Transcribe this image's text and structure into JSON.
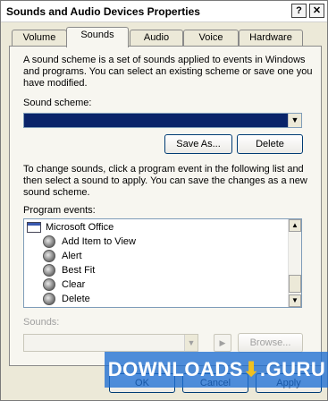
{
  "window": {
    "title": "Sounds and Audio Devices Properties",
    "help_glyph": "?",
    "close_glyph": "✕"
  },
  "tabs": [
    {
      "label": "Volume",
      "active": false
    },
    {
      "label": "Sounds",
      "active": true
    },
    {
      "label": "Audio",
      "active": false
    },
    {
      "label": "Voice",
      "active": false
    },
    {
      "label": "Hardware",
      "active": false
    }
  ],
  "sounds": {
    "intro": [
      "A sound scheme is a set of sounds applied to events in Windows",
      "and programs.  You can select an existing scheme or save one you",
      "have modified."
    ],
    "scheme_label": "Sound scheme:",
    "scheme_value": "",
    "save_as_label": "Save As...",
    "delete_label": "Delete",
    "change_text": [
      "To change sounds, click a program event in the following list and",
      "then select a sound to apply.  You can save the changes as a new",
      "sound scheme."
    ],
    "events_label": "Program events:",
    "events": [
      {
        "label": "Microsoft Office",
        "icon": "office-icon",
        "group": true
      },
      {
        "label": "Add Item to View",
        "icon": "speaker-icon",
        "group": false
      },
      {
        "label": "Alert",
        "icon": "speaker-icon",
        "group": false
      },
      {
        "label": "Best Fit",
        "icon": "speaker-icon",
        "group": false
      },
      {
        "label": "Clear",
        "icon": "speaker-icon",
        "group": false
      },
      {
        "label": "Delete",
        "icon": "speaker-icon",
        "group": false
      }
    ],
    "sounds_label": "Sounds:",
    "sounds_value": "",
    "browse_label": "Browse..."
  },
  "footer": {
    "ok_label": "OK",
    "cancel_label": "Cancel",
    "apply_label": "Apply"
  },
  "watermark": {
    "text_left": "DOWNLOADS",
    "text_right": ".GURU",
    "arrow": "⬇"
  },
  "colors": {
    "dialog_bg": "#ece9d8",
    "selection": "#0a246a",
    "watermark": "#1e6ed2"
  }
}
